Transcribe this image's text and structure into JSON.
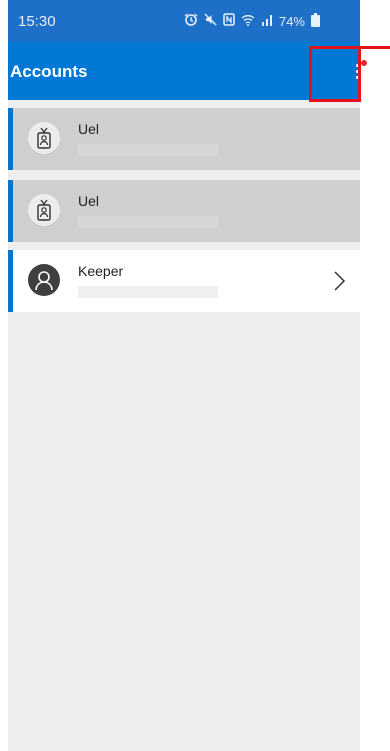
{
  "status_bar": {
    "time": "15:30",
    "battery": "74%",
    "icons": [
      "alarm-icon",
      "mute-icon",
      "nfc-icon",
      "wifi-icon",
      "signal-icon",
      "battery-icon"
    ]
  },
  "app_bar": {
    "title": "Accounts",
    "more_icon": "more-vertical-icon",
    "notification_color": "#e0262e"
  },
  "accounts": [
    {
      "name": "Uel",
      "icon": "badge-icon",
      "state": "disabled"
    },
    {
      "name": "Uel",
      "icon": "badge-icon",
      "state": "disabled"
    },
    {
      "name": "Keeper",
      "icon": "person-icon",
      "state": "active",
      "has_chevron": true
    }
  ],
  "colors": {
    "status_bar": "#1e6fc8",
    "app_bar": "#0078d4",
    "accent": "#0a74c8",
    "highlight": "#e4141b",
    "background": "#eeeeee"
  }
}
